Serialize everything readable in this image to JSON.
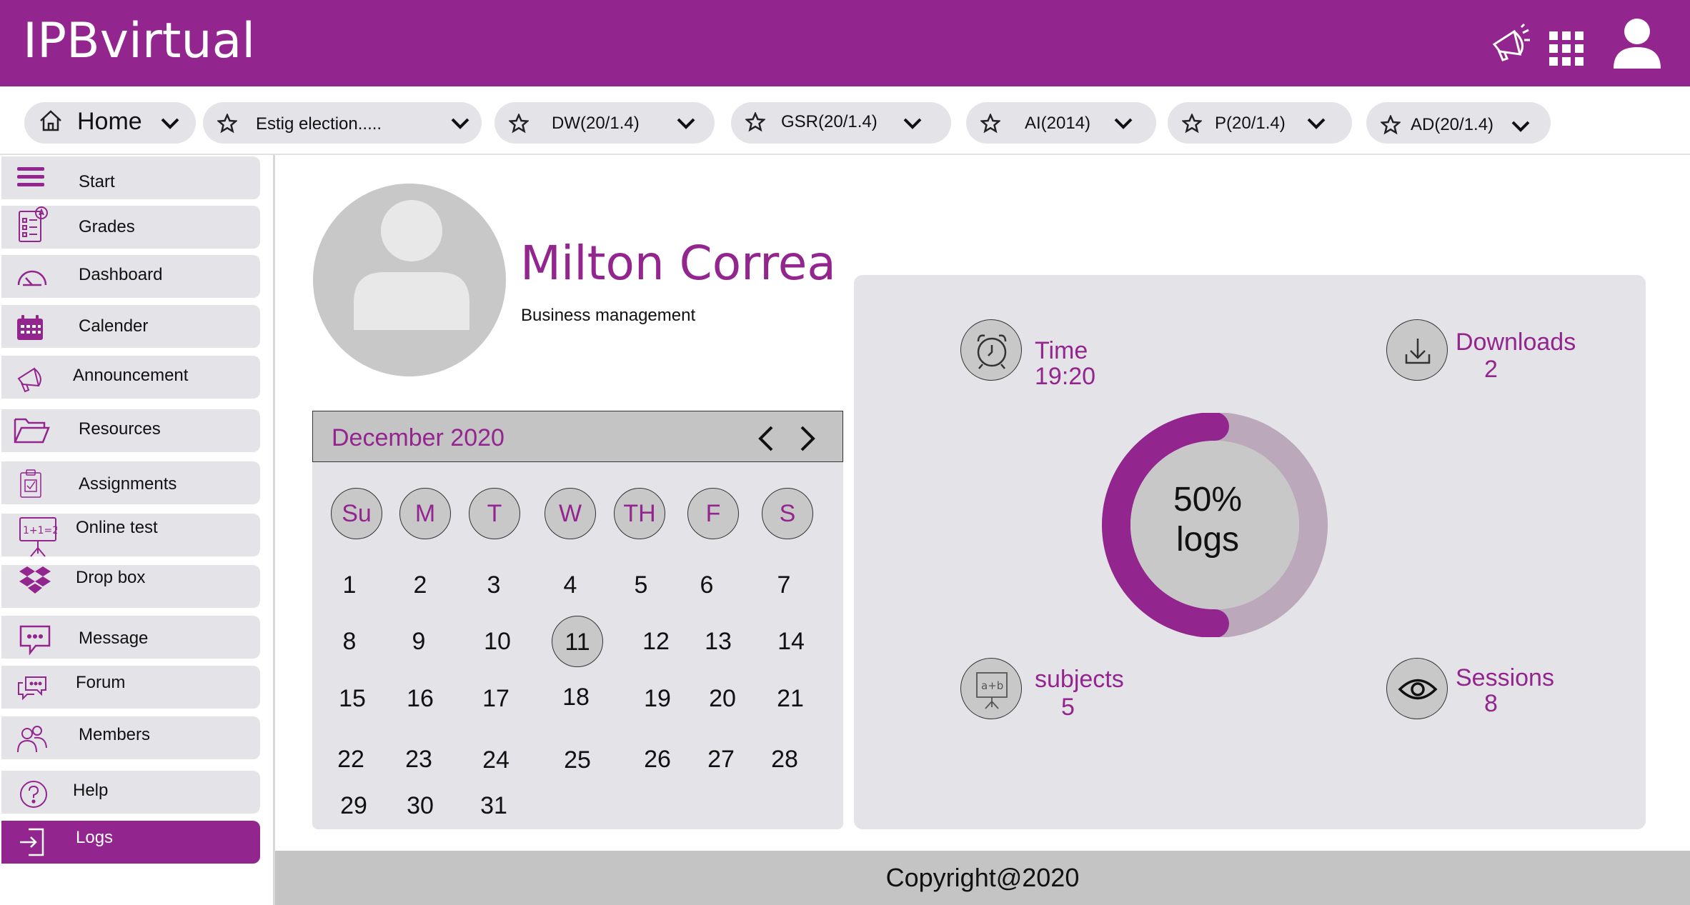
{
  "app": {
    "title": "IPBvirtual"
  },
  "header_icons": [
    "megaphone-icon",
    "apps-grid-icon",
    "user-icon"
  ],
  "tabs": [
    {
      "label": "Home",
      "icon": "home-icon"
    },
    {
      "label": "Estig election.....",
      "icon": "star-icon"
    },
    {
      "label": "DW(20/1.4)",
      "icon": "star-icon"
    },
    {
      "label": "GSR(20/1.4)",
      "icon": "star-icon"
    },
    {
      "label": "AI(2014)",
      "icon": "star-icon"
    },
    {
      "label": "P(20/1.4)",
      "icon": "star-icon"
    },
    {
      "label": "AD(20/1.4)",
      "icon": "star-icon"
    }
  ],
  "sidebar": {
    "items": [
      {
        "label": "Start",
        "icon": "menu-icon"
      },
      {
        "label": "Grades",
        "icon": "grades-icon"
      },
      {
        "label": "Dashboard",
        "icon": "gauge-icon"
      },
      {
        "label": "Calender",
        "icon": "calendar-icon"
      },
      {
        "label": "Announcement",
        "icon": "megaphone-icon"
      },
      {
        "label": "Resources",
        "icon": "folder-icon"
      },
      {
        "label": "Assignments",
        "icon": "clipboard-icon"
      },
      {
        "label": "Online test",
        "icon": "test-board-icon"
      },
      {
        "label": "Drop box",
        "icon": "dropbox-icon"
      },
      {
        "label": "Message",
        "icon": "message-icon"
      },
      {
        "label": "Forum",
        "icon": "forum-icon"
      },
      {
        "label": "Members",
        "icon": "members-icon"
      },
      {
        "label": "Help",
        "icon": "help-icon"
      },
      {
        "label": "Logs",
        "icon": "login-icon",
        "active": true
      }
    ]
  },
  "profile": {
    "name": "Milton Correa",
    "department": "Business management"
  },
  "calendar": {
    "month_label": "December 2020",
    "weekdays": [
      "Su",
      "M",
      "T",
      "W",
      "TH",
      "F",
      "S"
    ],
    "days": [
      "1",
      "2",
      "3",
      "4",
      "5",
      "6",
      "7",
      "8",
      "9",
      "10",
      "11",
      "12",
      "13",
      "14",
      "15",
      "16",
      "17",
      "18",
      "19",
      "20",
      "21",
      "22",
      "23",
      "24",
      "25",
      "26",
      "27",
      "28",
      "29",
      "30",
      "31"
    ],
    "selected_day": "11"
  },
  "stats": {
    "time": {
      "label": "Time",
      "value": "19:20",
      "icon": "alarm-clock-icon"
    },
    "downloads": {
      "label": "Downloads",
      "value": "2",
      "icon": "download-icon"
    },
    "subjects": {
      "label": "subjects",
      "value": "5",
      "icon": "board-icon"
    },
    "sessions": {
      "label": "Sessions",
      "value": "8",
      "icon": "eye-icon"
    },
    "logs": {
      "percent_label": "50%",
      "unit_label": "logs",
      "fraction": 0.5
    }
  },
  "footer": {
    "text": "Copyright@2020"
  },
  "colors": {
    "brand": "#93258f",
    "panel": "#e4e4e8",
    "circle": "#c8c8c8",
    "ring_track": "#b9a3b8"
  }
}
